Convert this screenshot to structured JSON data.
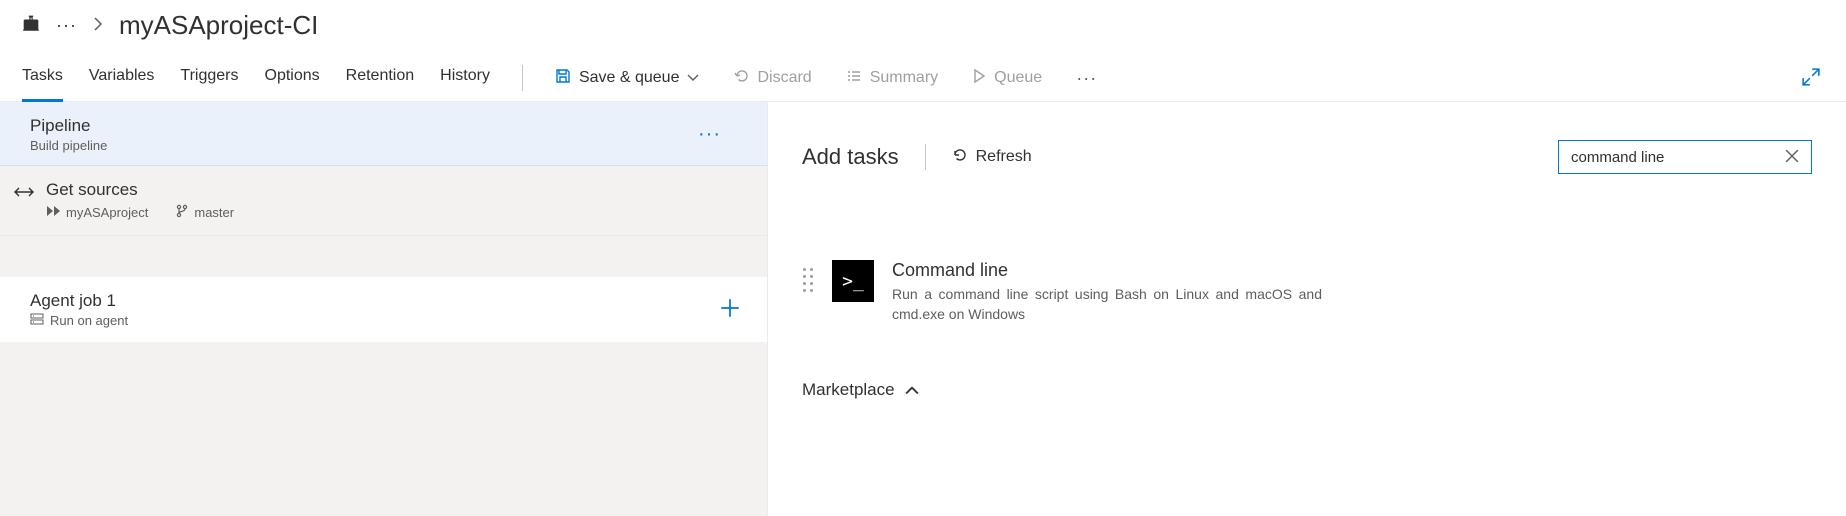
{
  "breadcrumb": {
    "title": "myASAproject-CI",
    "more": "···"
  },
  "tabs": {
    "tasks": "Tasks",
    "variables": "Variables",
    "triggers": "Triggers",
    "options": "Options",
    "retention": "Retention",
    "history": "History"
  },
  "toolbar": {
    "save_queue": "Save & queue",
    "discard": "Discard",
    "summary": "Summary",
    "queue": "Queue",
    "more": "···"
  },
  "pipeline": {
    "title": "Pipeline",
    "subtitle": "Build pipeline",
    "more": "···"
  },
  "sources": {
    "title": "Get sources",
    "repo": "myASAproject",
    "branch": "master"
  },
  "agent_job": {
    "title": "Agent job 1",
    "subtitle": "Run on agent"
  },
  "right": {
    "title": "Add tasks",
    "refresh": "Refresh",
    "search_value": "command line"
  },
  "task_result": {
    "name": "Command line",
    "desc": "Run a command line script using Bash on Linux and macOS and cmd.exe on Windows",
    "icon_text": ">_"
  },
  "marketplace": {
    "label": "Marketplace"
  }
}
